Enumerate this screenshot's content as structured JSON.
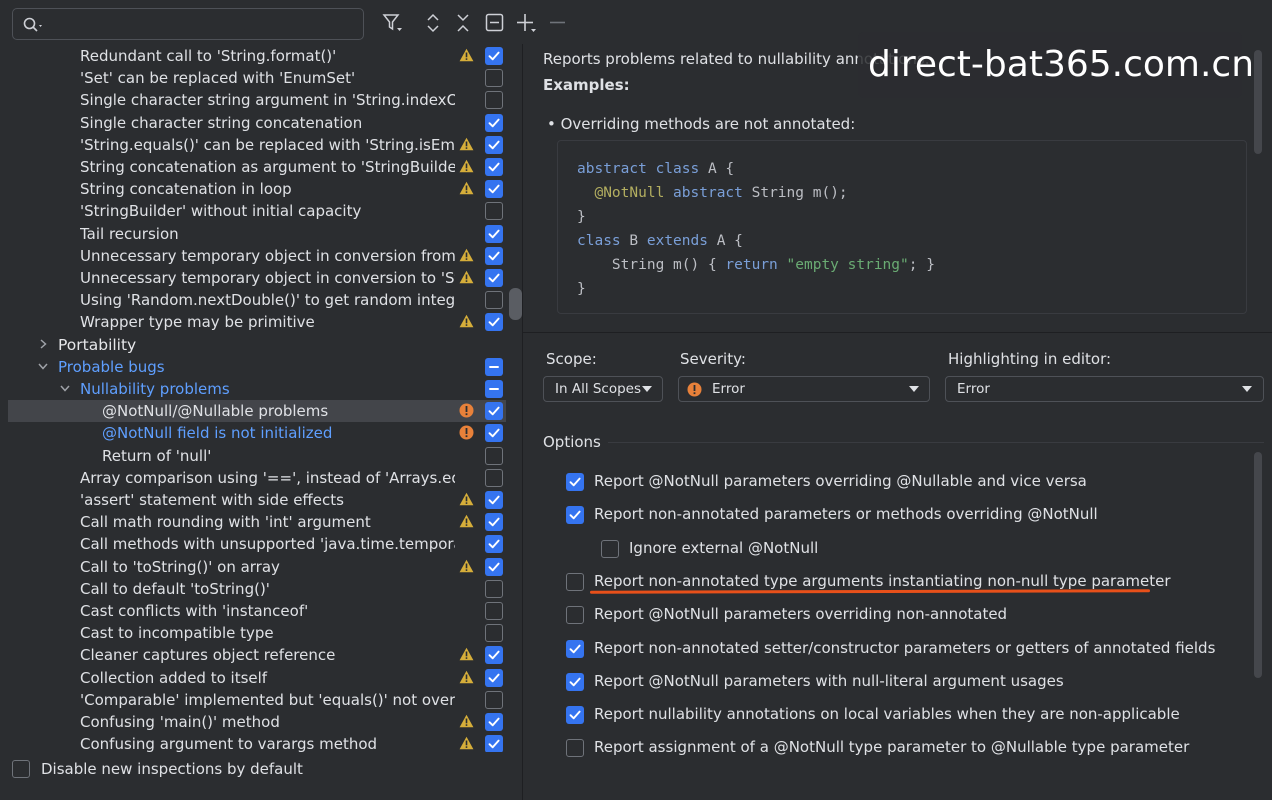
{
  "search": {
    "placeholder": ""
  },
  "toolbar": {
    "icons": [
      "filter-icon",
      "expand-all-icon",
      "collapse-all-icon",
      "reset-icon",
      "add-icon",
      "remove-icon"
    ]
  },
  "tree": {
    "rows": [
      {
        "label": "Redundant call to 'String.format()'",
        "indent": 80,
        "warn": true,
        "check": "on"
      },
      {
        "label": "'Set' can be replaced with 'EnumSet'",
        "indent": 80,
        "warn": false,
        "check": "off"
      },
      {
        "label": "Single character string argument in 'String.indexOf()'",
        "indent": 80,
        "warn": false,
        "check": "off"
      },
      {
        "label": "Single character string concatenation",
        "indent": 80,
        "warn": false,
        "check": "on"
      },
      {
        "label": "'String.equals()' can be replaced with 'String.isEmpty()'",
        "indent": 80,
        "warn": true,
        "check": "on"
      },
      {
        "label": "String concatenation as argument to 'StringBuilder.append()'",
        "indent": 80,
        "warn": true,
        "check": "on"
      },
      {
        "label": "String concatenation in loop",
        "indent": 80,
        "warn": true,
        "check": "on"
      },
      {
        "label": "'StringBuilder' without initial capacity",
        "indent": 80,
        "warn": false,
        "check": "off"
      },
      {
        "label": "Tail recursion",
        "indent": 80,
        "warn": false,
        "check": "on"
      },
      {
        "label": "Unnecessary temporary object in conversion from 'String'",
        "indent": 80,
        "warn": true,
        "check": "on"
      },
      {
        "label": "Unnecessary temporary object in conversion to 'String'",
        "indent": 80,
        "warn": true,
        "check": "on"
      },
      {
        "label": "Using 'Random.nextDouble()' to get random integer",
        "indent": 80,
        "warn": false,
        "check": "off"
      },
      {
        "label": "Wrapper type may be primitive",
        "indent": 80,
        "warn": true,
        "check": "on"
      },
      {
        "label": "Portability",
        "indent": 58,
        "chevron": "right",
        "bold": true,
        "check": "none"
      },
      {
        "label": "Probable bugs",
        "indent": 58,
        "chevron": "down",
        "blue": true,
        "check": "partial"
      },
      {
        "label": "Nullability problems",
        "indent": 80,
        "chevron": "down",
        "blue": true,
        "check": "partial"
      },
      {
        "label": "@NotNull/@Nullable problems",
        "indent": 102,
        "err": true,
        "check": "on",
        "selected": true
      },
      {
        "label": "@NotNull field is not initialized",
        "indent": 102,
        "err": true,
        "check": "on",
        "blue": true
      },
      {
        "label": "Return of 'null'",
        "indent": 102,
        "warn": false,
        "check": "off"
      },
      {
        "label": "Array comparison using '==', instead of 'Arrays.equals()'",
        "indent": 80,
        "warn": false,
        "check": "off"
      },
      {
        "label": "'assert' statement with side effects",
        "indent": 80,
        "warn": true,
        "check": "on"
      },
      {
        "label": "Call math rounding with 'int' argument",
        "indent": 80,
        "warn": true,
        "check": "on"
      },
      {
        "label": "Call methods with unsupported 'java.time.temporal.ChronoUnit'",
        "indent": 80,
        "warn": false,
        "check": "on"
      },
      {
        "label": "Call to 'toString()' on array",
        "indent": 80,
        "warn": true,
        "check": "on"
      },
      {
        "label": "Call to default 'toString()'",
        "indent": 80,
        "warn": false,
        "check": "off"
      },
      {
        "label": "Cast conflicts with 'instanceof'",
        "indent": 80,
        "warn": false,
        "check": "off"
      },
      {
        "label": "Cast to incompatible type",
        "indent": 80,
        "warn": false,
        "check": "off"
      },
      {
        "label": "Cleaner captures object reference",
        "indent": 80,
        "warn": true,
        "check": "on"
      },
      {
        "label": "Collection added to itself",
        "indent": 80,
        "warn": true,
        "check": "on"
      },
      {
        "label": "'Comparable' implemented but 'equals()' not overridden",
        "indent": 80,
        "warn": false,
        "check": "off"
      },
      {
        "label": "Confusing 'main()' method",
        "indent": 80,
        "warn": true,
        "check": "on"
      },
      {
        "label": "Confusing argument to varargs method",
        "indent": 80,
        "warn": true,
        "check": "on"
      }
    ]
  },
  "bottom": {
    "disable_label": "Disable new inspections by default"
  },
  "description": {
    "text": "Reports problems related to nullability annotations.",
    "examples_title": "Examples:",
    "bullet": "• Overriding methods are not annotated:",
    "code": {
      "l1a": "abstract class",
      "l1b": " A {",
      "l2a": "  @NotNull",
      "l2b": " abstract",
      "l2c": " String m();",
      "l3": "}",
      "l4a": "class",
      "l4b": " B ",
      "l4c": "extends",
      "l4d": " A {",
      "l5a": "    String m() { ",
      "l5b": "return",
      "l5c": " \"empty string\"",
      "l5d": "; }",
      "l6": "}"
    }
  },
  "watermark": {
    "text": "direct-bat365.com.cn"
  },
  "fields": {
    "scope_label": "Scope:",
    "scope_value": "In All Scopes",
    "severity_label": "Severity:",
    "severity_value": "Error",
    "highlight_label": "Highlighting in editor:",
    "highlight_value": "Error"
  },
  "options": {
    "title": "Options",
    "items": [
      {
        "label": "Report @NotNull parameters overriding @Nullable and vice versa",
        "checked": true,
        "indent": 0
      },
      {
        "label": "Report non-annotated parameters or methods overriding @NotNull",
        "checked": true,
        "indent": 0
      },
      {
        "label": "Ignore external @NotNull",
        "checked": false,
        "indent": 1
      },
      {
        "label": "Report non-annotated type arguments instantiating non-null type parameter",
        "checked": false,
        "indent": 0
      },
      {
        "label": "Report @NotNull parameters overriding non-annotated",
        "checked": false,
        "indent": 0
      },
      {
        "label": "Report non-annotated setter/constructor parameters or getters of annotated fields",
        "checked": true,
        "indent": 0
      },
      {
        "label": "Report @NotNull parameters with null-literal argument usages",
        "checked": true,
        "indent": 0
      },
      {
        "label": "Report nullability annotations on local variables when they are non-applicable",
        "checked": true,
        "indent": 0
      },
      {
        "label": "Report assignment of a @NotNull type parameter to @Nullable type parameter",
        "checked": false,
        "indent": 0
      }
    ]
  },
  "colors": {
    "accent": "#3574f0",
    "warning": "#d6ae3a",
    "error": "#e8813a",
    "highlight": "#e8501a"
  }
}
